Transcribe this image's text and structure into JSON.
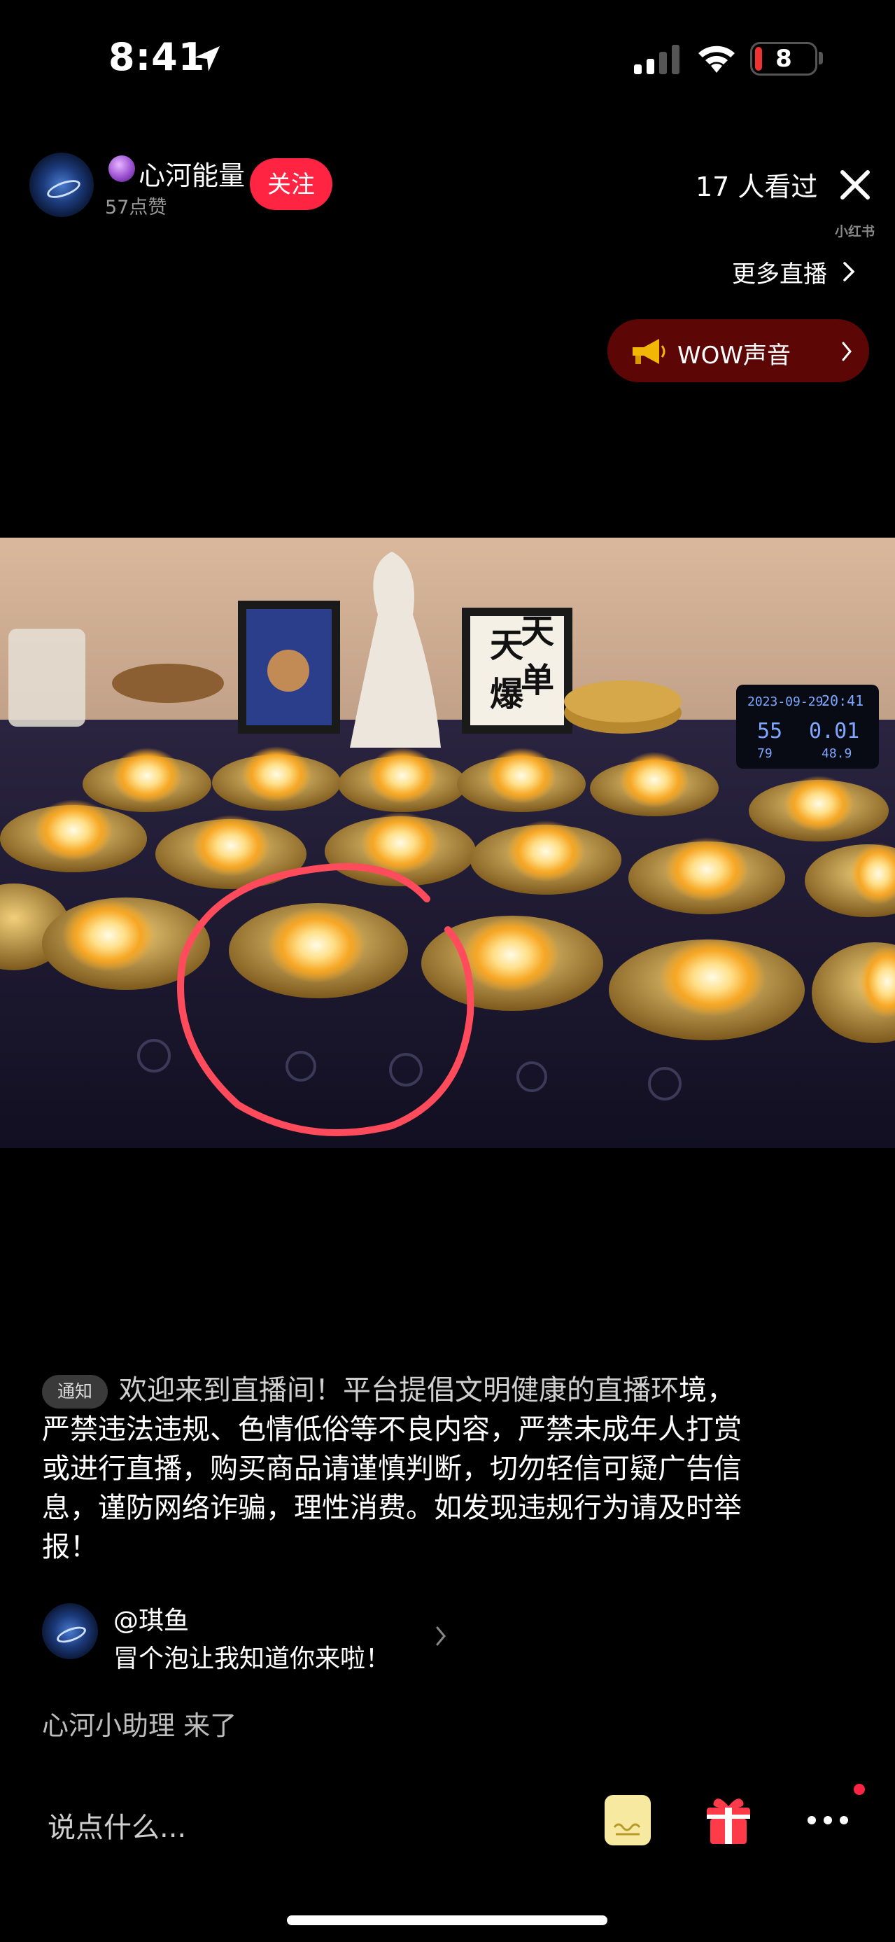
{
  "status_bar": {
    "time": "8:41",
    "battery": "8"
  },
  "header": {
    "user_name": "心河能量",
    "likes": "57点赞",
    "follow_label": "关注",
    "viewers": "17 人看过",
    "watermark": "小红书"
  },
  "more_live": {
    "label": "更多直播"
  },
  "wow_button": {
    "label": "WOW声音"
  },
  "video": {
    "clock_date": "2023-09-29",
    "clock_time": "20:41",
    "clock_temp": "55",
    "clock_value": "0.01",
    "clock_sub1": "79",
    "clock_sub2": "48.9",
    "frame_text_1": "天",
    "frame_text_2": "天",
    "frame_text_3": "爆",
    "frame_text_4": "单"
  },
  "chat": {
    "notice_tag": "通知",
    "notice_first": "欢迎来到直播间！平台提倡文明健康的直播环",
    "notice_rest": "境，严禁违法违规、色情低俗等不良内容，严禁未成年人打赏或进行直播，购买商品请谨慎判断，切勿轻信可疑广告信息，谨防网络诈骗，理性消费。如发现违规行为请及时举报！",
    "message_name": "@琪鱼",
    "message_text": "冒个泡让我知道你来啦！",
    "join_text": "心河小助理 来了"
  },
  "bottom_bar": {
    "input_placeholder": "说点什么..."
  },
  "colors": {
    "background": "#000000",
    "follow": "#ff2442",
    "wow_button": "#5c0606",
    "annotation_circle": "#ff4b5c"
  }
}
